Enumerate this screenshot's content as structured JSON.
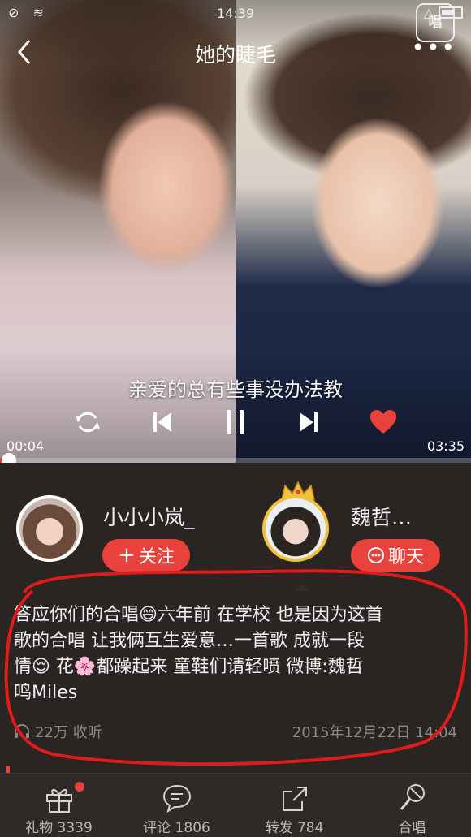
{
  "status_bar": {
    "time": "14:39"
  },
  "header": {
    "title": "她的睫毛",
    "app_badge": "唱"
  },
  "player": {
    "lyric": "亲爱的总有些事没办法教",
    "current_time": "00:04",
    "total_time": "03:35",
    "progress": 0.019
  },
  "singers": [
    {
      "name": "小小小岚_",
      "action_label": "关注"
    },
    {
      "name": "魏哲…",
      "action_label": "聊天"
    }
  ],
  "description": {
    "lines": [
      "答应你们的合唱😄六年前 在学校  也是因为这首",
      "歌的合唱  让我俩互生爱意…一首歌  成就一段",
      "情😌  花🌸都躁起来     童鞋们请轻喷     微博:魏哲",
      "鸣Miles"
    ]
  },
  "stats": {
    "listens": "22万 收听",
    "date": "2015年12月22日 14:04"
  },
  "colors": {
    "accent": "#e9423c",
    "background": "#2a2522",
    "annotation": "#e01b1b"
  },
  "tabbar": [
    {
      "label": "礼物 3339",
      "icon": "gift-icon"
    },
    {
      "label": "评论 1806",
      "icon": "comment-icon"
    },
    {
      "label": "转发 784",
      "icon": "share-icon"
    },
    {
      "label": "合唱",
      "icon": "chorus-mic-icon"
    }
  ]
}
